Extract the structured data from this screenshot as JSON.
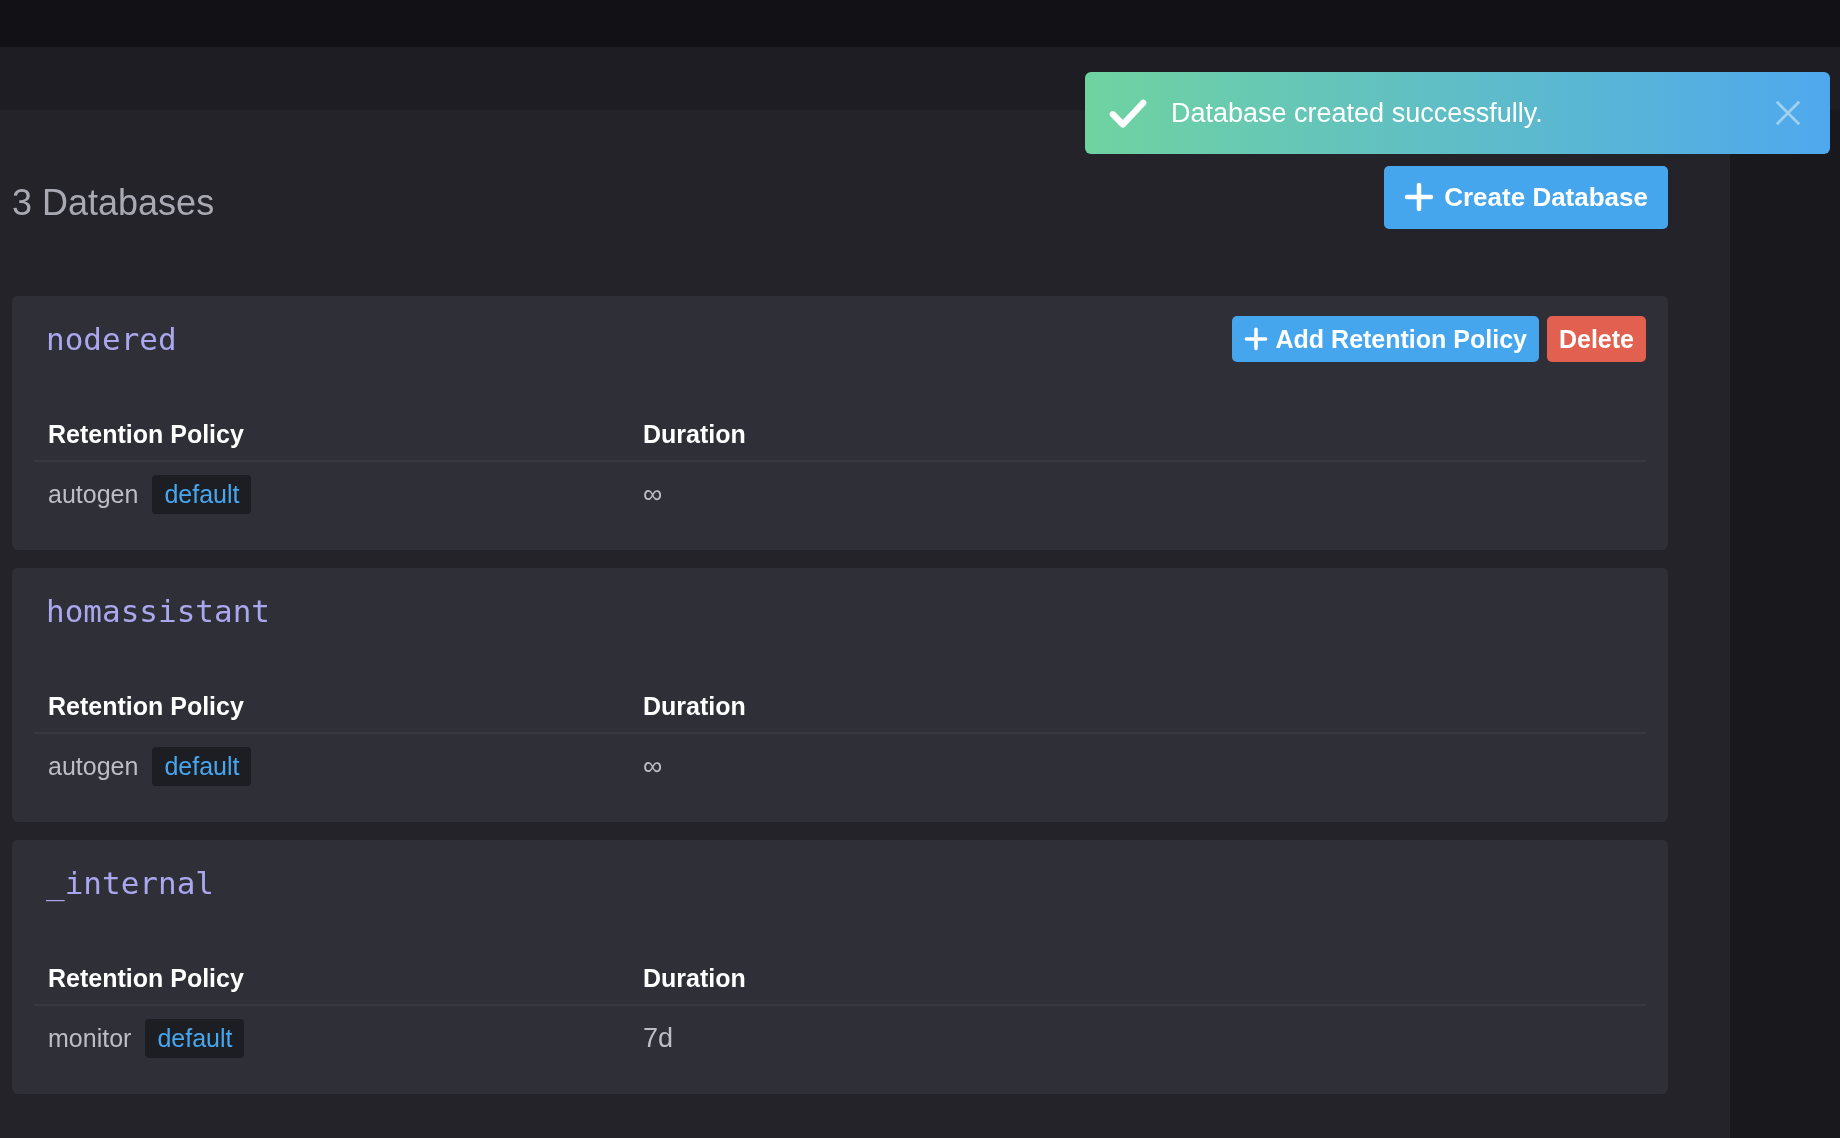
{
  "toast": {
    "kind": "success",
    "message": "Database created successfully."
  },
  "header": {
    "count_title": "3 Databases",
    "create_button": "Create Database"
  },
  "databases": [
    {
      "name": "nodered",
      "actions": [
        {
          "kind": "primary",
          "label": "Add Retention Policy"
        },
        {
          "kind": "danger",
          "label": "Delete"
        }
      ],
      "columns": [
        "Retention Policy",
        "Duration"
      ],
      "policies": [
        {
          "name": "autogen",
          "tag": "default",
          "duration": "∞"
        }
      ]
    },
    {
      "name": "homassistant",
      "columns": [
        "Retention Policy",
        "Duration"
      ],
      "policies": [
        {
          "name": "autogen",
          "tag": "default",
          "duration": "∞"
        }
      ]
    },
    {
      "name": "_internal",
      "columns": [
        "Retention Policy",
        "Duration"
      ],
      "policies": [
        {
          "name": "monitor",
          "tag": "default",
          "duration": "7d"
        }
      ]
    }
  ]
}
